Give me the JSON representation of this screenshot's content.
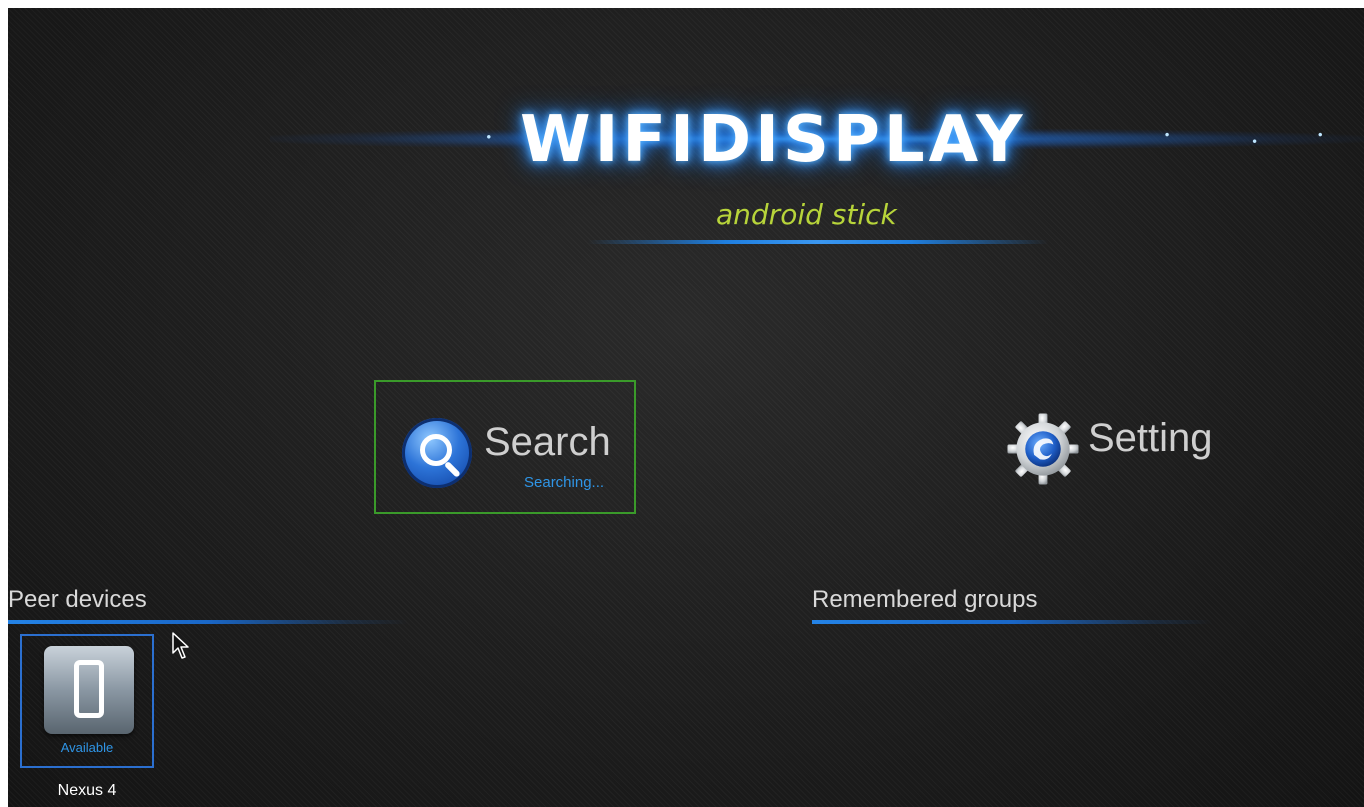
{
  "logo": {
    "title": "WIFIDISPLAY",
    "subtitle": "android stick"
  },
  "actions": {
    "search": {
      "label": "Search",
      "status": "Searching...",
      "icon": "search-icon"
    },
    "setting": {
      "label": "Setting",
      "icon": "gear-icon"
    }
  },
  "sections": {
    "peer_devices": {
      "title": "Peer devices"
    },
    "remembered_groups": {
      "title": "Remembered groups"
    }
  },
  "devices": [
    {
      "name": "Nexus 4",
      "status": "Available",
      "icon": "phone-icon"
    }
  ],
  "colors": {
    "accent_blue": "#2f95e6",
    "focus_green": "#3a9a2a",
    "subtitle_green": "#b7d43a",
    "background": "#1d1d1d"
  }
}
